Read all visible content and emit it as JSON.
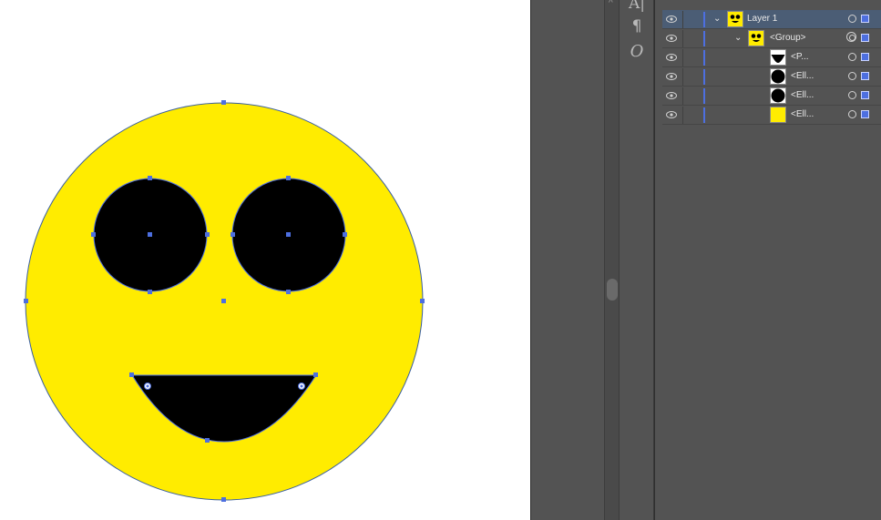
{
  "canvas": {
    "artwork": "smiley-face",
    "colors": {
      "face": "#ffec00",
      "features": "#000000",
      "selection": "#4d6fe0",
      "outline": "#3a5fa0"
    }
  },
  "toolbar": {
    "tools": [
      {
        "icon": "character-style-icon",
        "glyph": "A|"
      },
      {
        "icon": "paragraph-icon",
        "glyph": "¶"
      },
      {
        "icon": "opentype-icon",
        "glyph": "O"
      }
    ]
  },
  "layers": {
    "rows": [
      {
        "name": "Layer 1",
        "thumb": "smiley-thumb",
        "expanded": true,
        "indent": 0,
        "selected": true,
        "target": "single"
      },
      {
        "name": "<Group>",
        "thumb": "smiley-thumb",
        "expanded": true,
        "indent": 1,
        "selected": false,
        "target": "double"
      },
      {
        "name": "<P...",
        "thumb": "path-thumb",
        "indent": 2,
        "selected": false,
        "target": "single"
      },
      {
        "name": "<Ell...",
        "thumb": "black-ellipse-thumb",
        "indent": 2,
        "selected": false,
        "target": "single"
      },
      {
        "name": "<Ell...",
        "thumb": "black-ellipse-thumb",
        "indent": 2,
        "selected": false,
        "target": "single"
      },
      {
        "name": "<Ell...",
        "thumb": "yellow-ellipse-thumb",
        "indent": 2,
        "selected": false,
        "target": "single"
      }
    ]
  }
}
